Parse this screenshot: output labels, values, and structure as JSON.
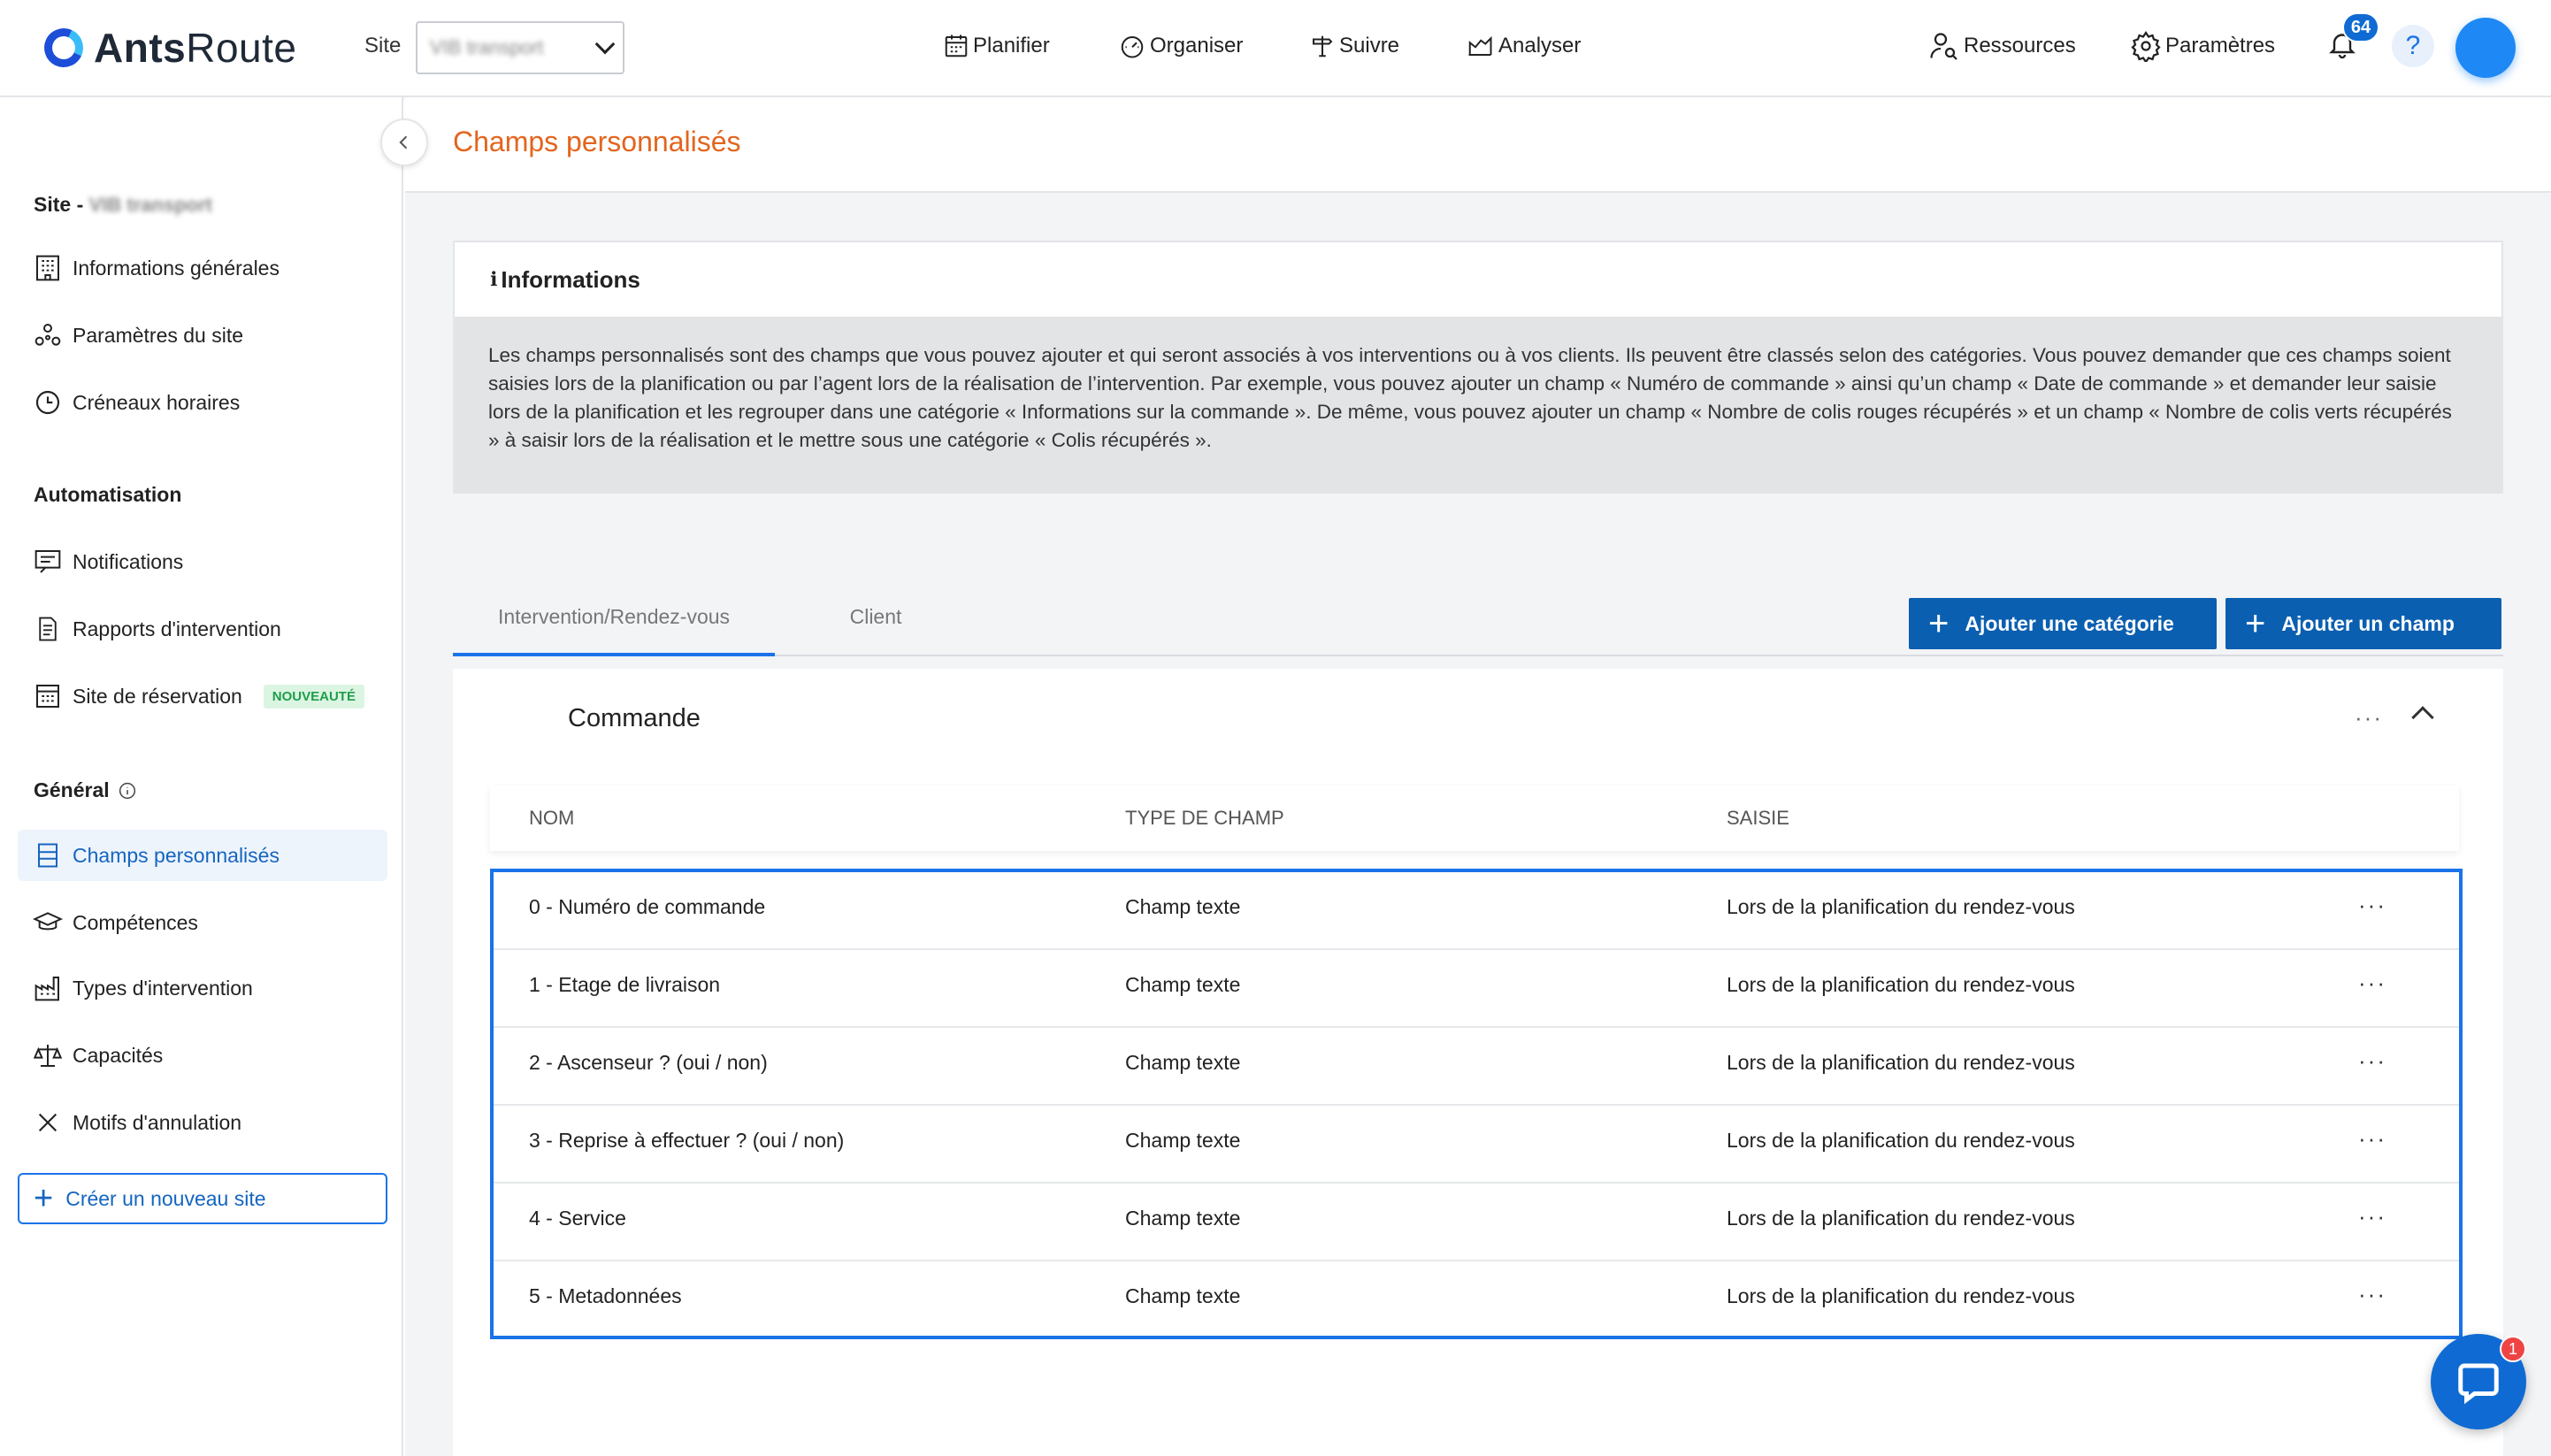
{
  "app": {
    "name_bold": "Ants",
    "name_light": "Route"
  },
  "header": {
    "site_label": "Site",
    "site_value": "VIB transport",
    "nav": [
      "Planifier",
      "Organiser",
      "Suivre",
      "Analyser"
    ],
    "resources": "Ressources",
    "settings": "Paramètres",
    "notifications_count": "64",
    "help": "?"
  },
  "sidebar": {
    "site_title": "Site -",
    "site_name": "VIB transport",
    "site_items": [
      "Informations générales",
      "Paramètres du site",
      "Créneaux horaires"
    ],
    "automation_title": "Automatisation",
    "automation_items": [
      "Notifications",
      "Rapports d'intervention",
      "Site de réservation"
    ],
    "new_tag": "NOUVEAUTÉ",
    "general_title": "Général",
    "general_items": [
      "Champs personnalisés",
      "Compétences",
      "Types d'intervention",
      "Capacités",
      "Motifs d'annulation"
    ],
    "create_site": "Créer un nouveau site"
  },
  "page": {
    "title": "Champs personnalisés",
    "info_title": "Informations",
    "info_text": "Les champs personnalisés sont des champs que vous pouvez ajouter et qui seront associés à vos interventions ou à vos clients. Ils peuvent être classés selon des catégories. Vous pouvez demander que ces champs soient saisies lors de la planification ou par l’agent lors de la réalisation de l’intervention. Par exemple, vous pouvez ajouter un champ « Numéro de commande » ainsi qu’un champ « Date de commande » et demander leur saisie lors de la planification et les regrouper dans une catégorie « Informations sur la commande ». De même, vous pouvez ajouter un champ « Nombre de colis rouges récupérés » et un champ « Nombre de colis verts récupérés » à saisir lors de la réalisation et le mettre sous une catégorie « Colis récupérés ».",
    "tabs": [
      "Intervention/Rendez-vous",
      "Client"
    ],
    "add_category": "Ajouter une catégorie",
    "add_field": "Ajouter un champ"
  },
  "category": {
    "name": "Commande",
    "columns": [
      "NOM",
      "TYPE DE CHAMP",
      "SAISIE"
    ],
    "rows": [
      {
        "name": "0 - Numéro de commande",
        "type": "Champ texte",
        "input": "Lors de la planification du rendez-vous"
      },
      {
        "name": "1 - Etage de livraison",
        "type": "Champ texte",
        "input": "Lors de la planification du rendez-vous"
      },
      {
        "name": "2 - Ascenseur ? (oui / non)",
        "type": "Champ texte",
        "input": "Lors de la planification du rendez-vous"
      },
      {
        "name": "3 - Reprise à effectuer ? (oui / non)",
        "type": "Champ texte",
        "input": "Lors de la planification du rendez-vous"
      },
      {
        "name": "4 - Service",
        "type": "Champ texte",
        "input": "Lors de la planification du rendez-vous"
      },
      {
        "name": "5 - Metadonnées",
        "type": "Champ texte",
        "input": "Lors de la planification du rendez-vous"
      }
    ]
  },
  "chat": {
    "badge": "1"
  },
  "colors": {
    "accent": "#1a73e8",
    "primary_button": "#0b5fb0",
    "title": "#e3651d",
    "new_tag": "#1e9e4a"
  }
}
